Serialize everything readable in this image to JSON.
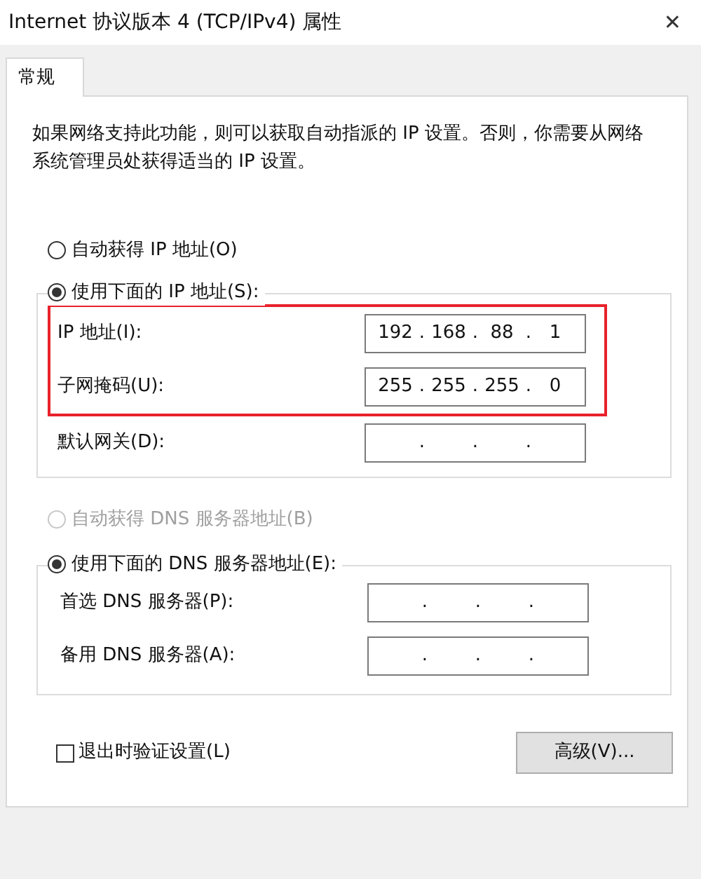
{
  "window": {
    "title": "Internet 协议版本 4 (TCP/IPv4) 属性",
    "close": "✕"
  },
  "tabs": [
    {
      "label": "常规",
      "selected": true
    }
  ],
  "description": "如果网络支持此功能，则可以获取自动指派的 IP 设置。否则，你需要从网络系统管理员处获得适当的 IP 设置。",
  "ip_auto": {
    "label": "自动获得 IP 地址(O)",
    "selected": false,
    "disabled": false
  },
  "ip_manual": {
    "label": "使用下面的 IP 地址(S):",
    "selected": true,
    "disabled": false
  },
  "ip_fields": [
    {
      "label": "IP 地址(I):",
      "octets": [
        "192",
        "168",
        "88",
        "1"
      ],
      "dots": [
        ".",
        ".",
        "."
      ],
      "highlighted": true
    },
    {
      "label": "子网掩码(U):",
      "octets": [
        "255",
        "255",
        "255",
        "0"
      ],
      "dots": [
        ".",
        ".",
        "."
      ],
      "highlighted": true
    },
    {
      "label": "默认网关(D):",
      "dots": [
        ".",
        ".",
        "."
      ]
    }
  ],
  "dns_auto": {
    "label": "自动获得 DNS 服务器地址(B)",
    "selected": false,
    "disabled": true
  },
  "dns_manual": {
    "label": "使用下面的 DNS 服务器地址(E):",
    "selected": true,
    "disabled": false
  },
  "dns_fields": [
    {
      "label": "首选 DNS 服务器(P):",
      "dots": [
        ".",
        ".",
        "."
      ]
    },
    {
      "label": "备用 DNS 服务器(A):",
      "dots": [
        ".",
        ".",
        "."
      ]
    }
  ],
  "validate": {
    "label": "退出时验证设置(L)",
    "checked": false
  },
  "advanced_button": "高级(V)..."
}
